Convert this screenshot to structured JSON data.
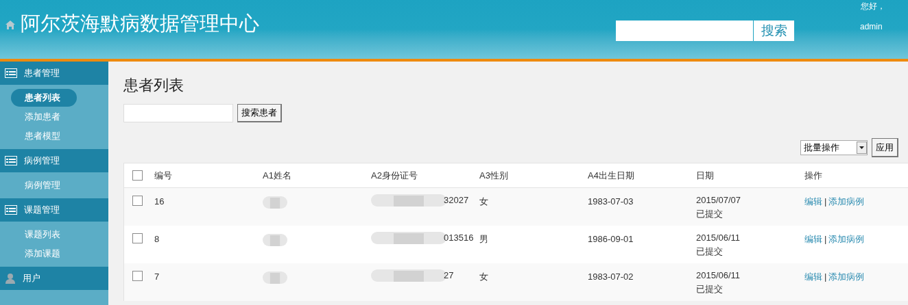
{
  "header": {
    "title": "阿尔茨海默病数据管理中心",
    "search_button": "搜索",
    "greeting": "您好，",
    "user": "admin"
  },
  "sidebar": [
    {
      "label": "患者管理",
      "kind": "list",
      "items": [
        {
          "label": "患者列表",
          "selected": true
        },
        {
          "label": "添加患者",
          "selected": false
        },
        {
          "label": "患者模型",
          "selected": false
        }
      ]
    },
    {
      "label": "病例管理",
      "kind": "list",
      "items": [
        {
          "label": "病例管理",
          "selected": false
        }
      ]
    },
    {
      "label": "课题管理",
      "kind": "list",
      "items": [
        {
          "label": "课题列表",
          "selected": false
        },
        {
          "label": "添加课题",
          "selected": false
        }
      ]
    },
    {
      "label": "用户",
      "kind": "user"
    }
  ],
  "page": {
    "title": "患者列表",
    "search_button": "搜索患者",
    "bulk_select": "批量操作",
    "apply_button": "应用"
  },
  "table": {
    "select_all_checked": false,
    "columns": [
      "编号",
      "A1姓名",
      "A2身份证号",
      "A3性别",
      "A4出生日期",
      "日期",
      "操作"
    ],
    "rows": [
      {
        "checked": false,
        "id": "16",
        "name_redacted": true,
        "id_number": "32027",
        "id_number_redacted": true,
        "sex": "女",
        "birth": "1983-07-03",
        "date": "2015/07/07",
        "status": "已提交",
        "actions": [
          "编辑",
          "添加病例"
        ],
        "separator": "|"
      },
      {
        "checked": false,
        "id": "8",
        "name_redacted": true,
        "id_number": "013516",
        "id_number_redacted": true,
        "sex": "男",
        "birth": "1986-09-01",
        "date": "2015/06/11",
        "status": "已提交",
        "actions": [
          "编辑",
          "添加病例"
        ],
        "separator": "|"
      },
      {
        "checked": false,
        "id": "7",
        "name_redacted": true,
        "id_number": "27",
        "id_number_redacted": true,
        "sex": "女",
        "birth": "1983-07-02",
        "date": "2015/06/11",
        "status": "已提交",
        "actions": [
          "编辑",
          "添加病例"
        ],
        "separator": "|"
      }
    ]
  }
}
